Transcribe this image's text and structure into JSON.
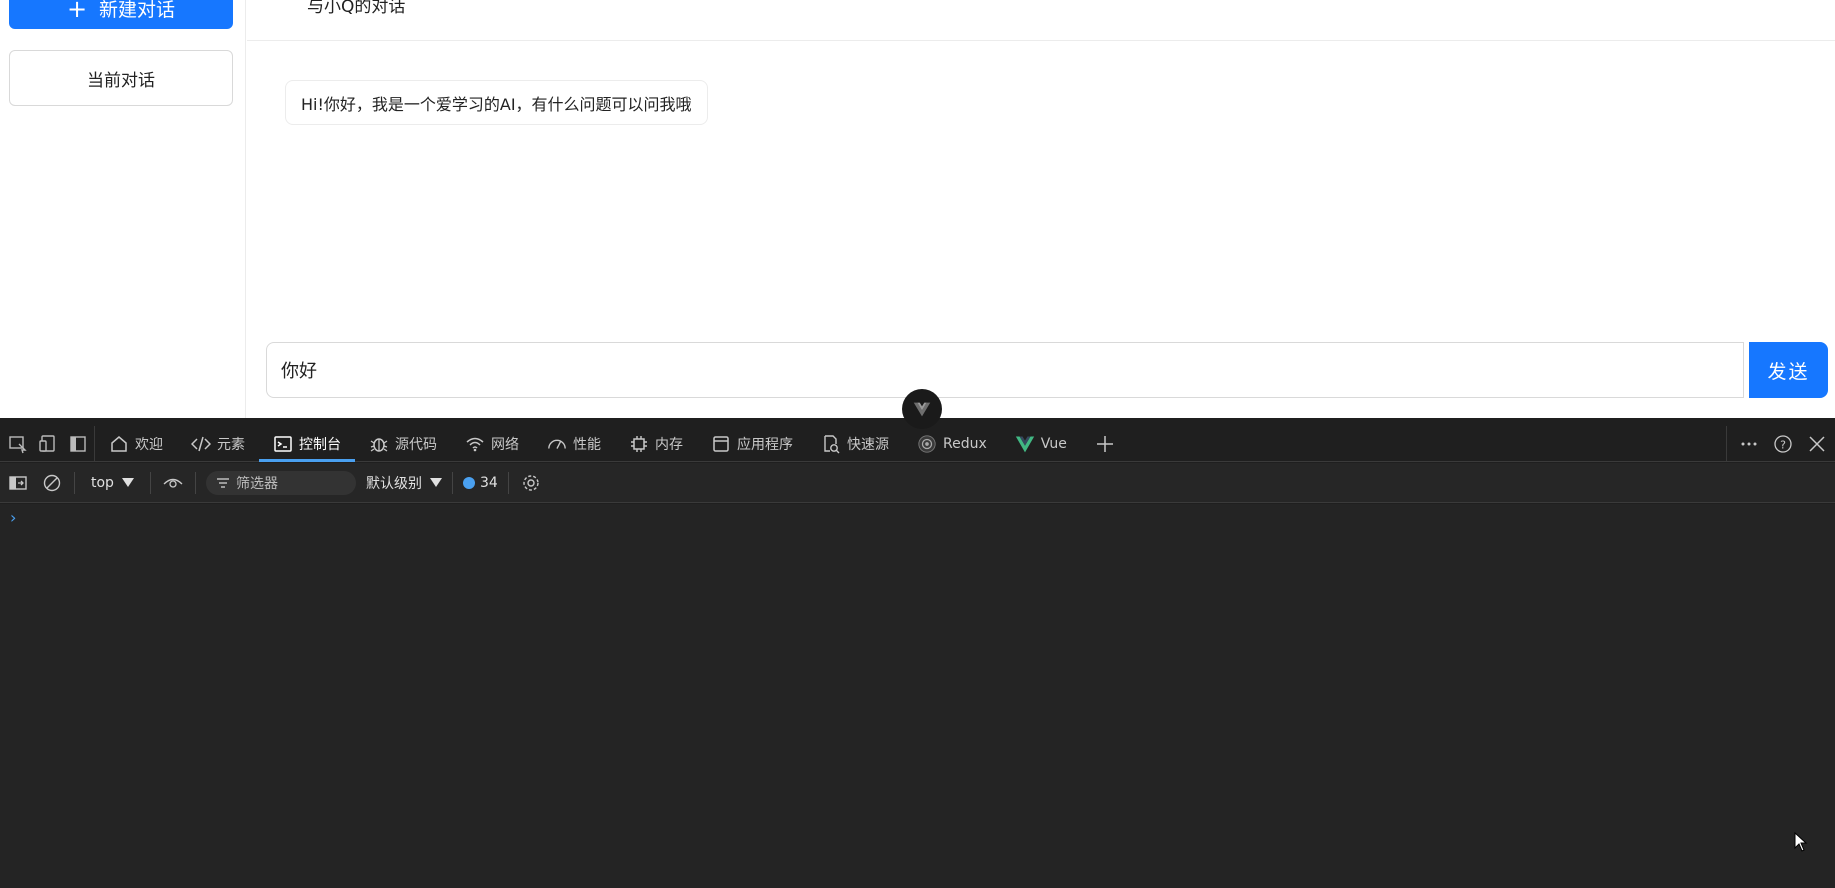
{
  "sidebar": {
    "new_chat_label": "新建对话",
    "current_chat_label": "当前对话"
  },
  "chat": {
    "header_title": "与小Q的对话",
    "assistant_message": "Hi!你好，我是一个爱学习的AI，有什么问题可以问我哦",
    "input_value": "你好",
    "send_label": "发送"
  },
  "devtools": {
    "tabs": [
      {
        "label": "欢迎",
        "icon": "home-icon"
      },
      {
        "label": "元素",
        "icon": "code-icon"
      },
      {
        "label": "控制台",
        "icon": "console-icon",
        "active": true
      },
      {
        "label": "源代码",
        "icon": "bug-icon"
      },
      {
        "label": "网络",
        "icon": "wifi-icon"
      },
      {
        "label": "性能",
        "icon": "gauge-icon"
      },
      {
        "label": "内存",
        "icon": "chip-icon"
      },
      {
        "label": "应用程序",
        "icon": "app-window-icon"
      },
      {
        "label": "快速源",
        "icon": "quick-source-icon"
      },
      {
        "label": "Redux",
        "icon": "redux-icon"
      },
      {
        "label": "Vue",
        "icon": "vue-logo-icon"
      }
    ],
    "toolbar": {
      "context": "top",
      "filter_placeholder": "筛选器",
      "level": "默认级别",
      "issues_count": "34"
    }
  },
  "colors": {
    "accent": "#1677ff",
    "devtools_bg": "#1f1f1f",
    "devtools_active": "#4aa0f0"
  }
}
